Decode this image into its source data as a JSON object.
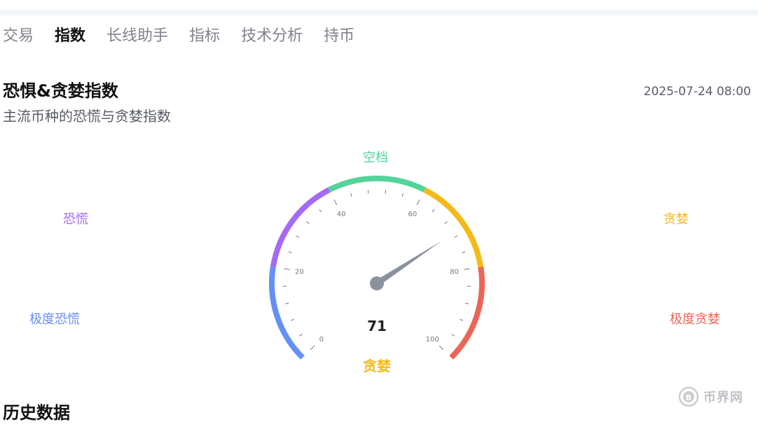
{
  "tabs": [
    {
      "label": "交易",
      "active": false
    },
    {
      "label": "指数",
      "active": true
    },
    {
      "label": "长线助手",
      "active": false
    },
    {
      "label": "指标",
      "active": false
    },
    {
      "label": "技术分析",
      "active": false
    },
    {
      "label": "持币",
      "active": false
    }
  ],
  "header": {
    "title": "恐惧&贪婪指数",
    "subtitle": "主流币种的恐慌与贪婪指数",
    "timestamp": "2025-07-24 08:00"
  },
  "legend": {
    "fear": "恐慌",
    "extreme_fear": "极度恐慌",
    "neutral": "空档",
    "greed": "贪婪",
    "extreme_greed": "极度贪婪"
  },
  "gauge": {
    "value": 71,
    "value_label": "71",
    "status": "贪婪",
    "min": 0,
    "max": 100,
    "tick_labels": [
      "0",
      "20",
      "40",
      "60",
      "80",
      "100"
    ],
    "segments": [
      {
        "from": 0,
        "to": 20,
        "color": "#6590f5"
      },
      {
        "from": 20,
        "to": 40,
        "color": "#a56af5"
      },
      {
        "from": 40,
        "to": 60,
        "color": "#52d49a"
      },
      {
        "from": 60,
        "to": 80,
        "color": "#f5b91a"
      },
      {
        "from": 80,
        "to": 100,
        "color": "#ea6657"
      }
    ],
    "needle_color": "#8a929e"
  },
  "colors": {
    "extreme_fear": "#6590f5",
    "fear": "#a56af5",
    "neutral": "#52d49a",
    "greed": "#f5b91a",
    "extreme_greed": "#ea6657"
  },
  "section": {
    "history_title": "历史数据"
  },
  "watermark": {
    "icon": "coin-logo-icon",
    "text": "币界网"
  }
}
